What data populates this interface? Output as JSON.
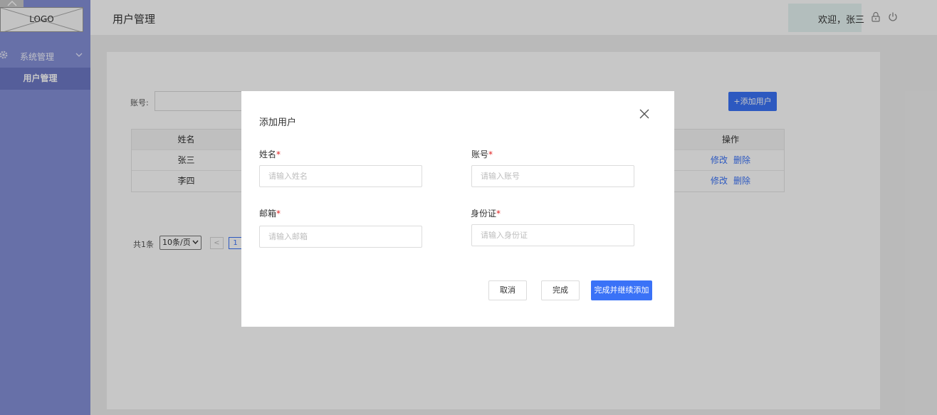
{
  "sidebar": {
    "logo": "LOGO",
    "group_label": "系统管理",
    "active_item": "用户管理"
  },
  "header": {
    "title": "用户管理",
    "welcome": "欢迎，张三"
  },
  "filter": {
    "account_label": "账号:",
    "add_user": "+添加用户"
  },
  "table": {
    "headers": {
      "name": "姓名",
      "actions": "操作"
    },
    "rows": [
      {
        "name": "张三",
        "edit": "修改",
        "delete": "删除"
      },
      {
        "name": "李四",
        "edit": "修改",
        "delete": "删除"
      }
    ]
  },
  "pagination": {
    "total": "共1条",
    "page_size": "10条/页",
    "prev": "<",
    "current_page": "1"
  },
  "modal": {
    "title": "添加用户",
    "required_mark": "*",
    "name_label": "姓名",
    "name_placeholder": "请输入姓名",
    "account_label": "账号",
    "account_placeholder": "请输入账号",
    "email_label": "邮箱",
    "email_placeholder": "请输入邮箱",
    "idcard_label": "身份证",
    "idcard_placeholder": "请输入身份证",
    "cancel": "取消",
    "done": "完成",
    "done_continue": "完成并继续添加"
  },
  "colors": {
    "sidebar": "#8590d8",
    "sidebar_active": "#6e79c6",
    "primary": "#3a72f7",
    "required": "#e02020"
  }
}
